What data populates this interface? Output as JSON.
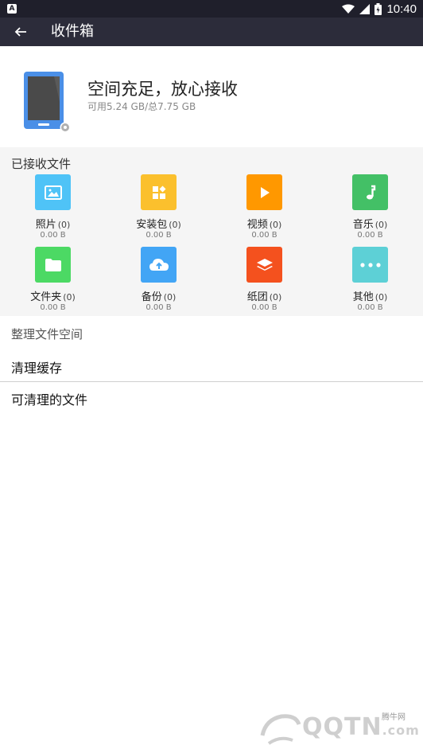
{
  "status_bar": {
    "time": "10:40"
  },
  "app_bar": {
    "title": "收件箱"
  },
  "storage": {
    "headline": "空间充足，放心接收",
    "detail": "可用5.24 GB/总7.75 GB"
  },
  "received": {
    "title": "已接收文件",
    "items": [
      {
        "label": "照片",
        "count": "(0)",
        "size": "0.00 B",
        "icon": "image-icon",
        "color": "#4fc3f7"
      },
      {
        "label": "安装包",
        "count": "(0)",
        "size": "0.00 B",
        "icon": "apps-icon",
        "color": "#fbc02d"
      },
      {
        "label": "视频",
        "count": "(0)",
        "size": "0.00 B",
        "icon": "play-icon",
        "color": "#ff9800"
      },
      {
        "label": "音乐",
        "count": "(0)",
        "size": "0.00 B",
        "icon": "music-note-icon",
        "color": "#43c066"
      },
      {
        "label": "文件夹",
        "count": "(0)",
        "size": "0.00 B",
        "icon": "folder-icon",
        "color": "#4cd964"
      },
      {
        "label": "备份",
        "count": "(0)",
        "size": "0.00 B",
        "icon": "cloud-upload-icon",
        "color": "#42a5f5"
      },
      {
        "label": "纸团",
        "count": "(0)",
        "size": "0.00 B",
        "icon": "layers-icon",
        "color": "#f4511e"
      },
      {
        "label": "其他",
        "count": "(0)",
        "size": "0.00 B",
        "icon": "more-icon",
        "color": "#5dd0d6"
      }
    ]
  },
  "cleanup": {
    "title": "整理文件空间",
    "clear_cache": "清理缓存",
    "cleanable_files": "可清理的文件"
  },
  "watermark": {
    "brand": "QQTN",
    "domain": ".com",
    "site": "腾牛网"
  }
}
